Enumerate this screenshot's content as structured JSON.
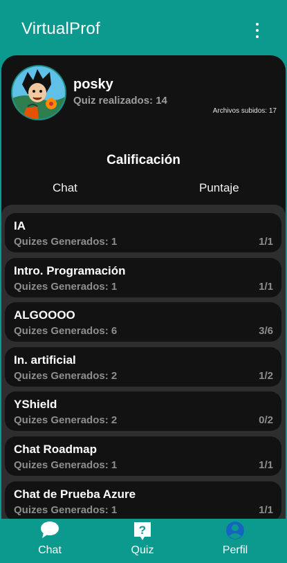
{
  "appbar": {
    "title": "VirtualProf",
    "menu_icon": "more-vert-icon"
  },
  "profile": {
    "username": "posky",
    "quizzes_done": "Quiz realizados: 14",
    "files_uploaded": "Archivos subidos: 17"
  },
  "section": {
    "title": "Calificación",
    "tabs": [
      {
        "label": "Chat"
      },
      {
        "label": "Puntaje"
      }
    ]
  },
  "chats": [
    {
      "name": "IA",
      "generated": "Quizes Generados: 1",
      "score": "1/1"
    },
    {
      "name": "Intro. Programación",
      "generated": "Quizes Generados: 1",
      "score": "1/1"
    },
    {
      "name": "ALGOOOO",
      "generated": "Quizes Generados: 6",
      "score": "3/6"
    },
    {
      "name": "In. artificial",
      "generated": "Quizes Generados: 2",
      "score": "1/2"
    },
    {
      "name": "YShield",
      "generated": "Quizes Generados: 2",
      "score": "0/2"
    },
    {
      "name": "Chat Roadmap",
      "generated": "Quizes Generados: 1",
      "score": "1/1"
    },
    {
      "name": "Chat de Prueba Azure",
      "generated": "Quizes Generados: 1",
      "score": "1/1"
    }
  ],
  "bottom_nav": [
    {
      "label": "Chat",
      "icon": "chat-bubble-icon"
    },
    {
      "label": "Quiz",
      "icon": "quiz-icon"
    },
    {
      "label": "Perfil",
      "icon": "account-circle-icon",
      "active": true
    }
  ],
  "colors": {
    "primary": "#0b9a8d",
    "surface": "#121212",
    "list_bg": "#2e2e2e",
    "muted_text": "#8e8e8e",
    "active_nav": "#1565c0"
  }
}
